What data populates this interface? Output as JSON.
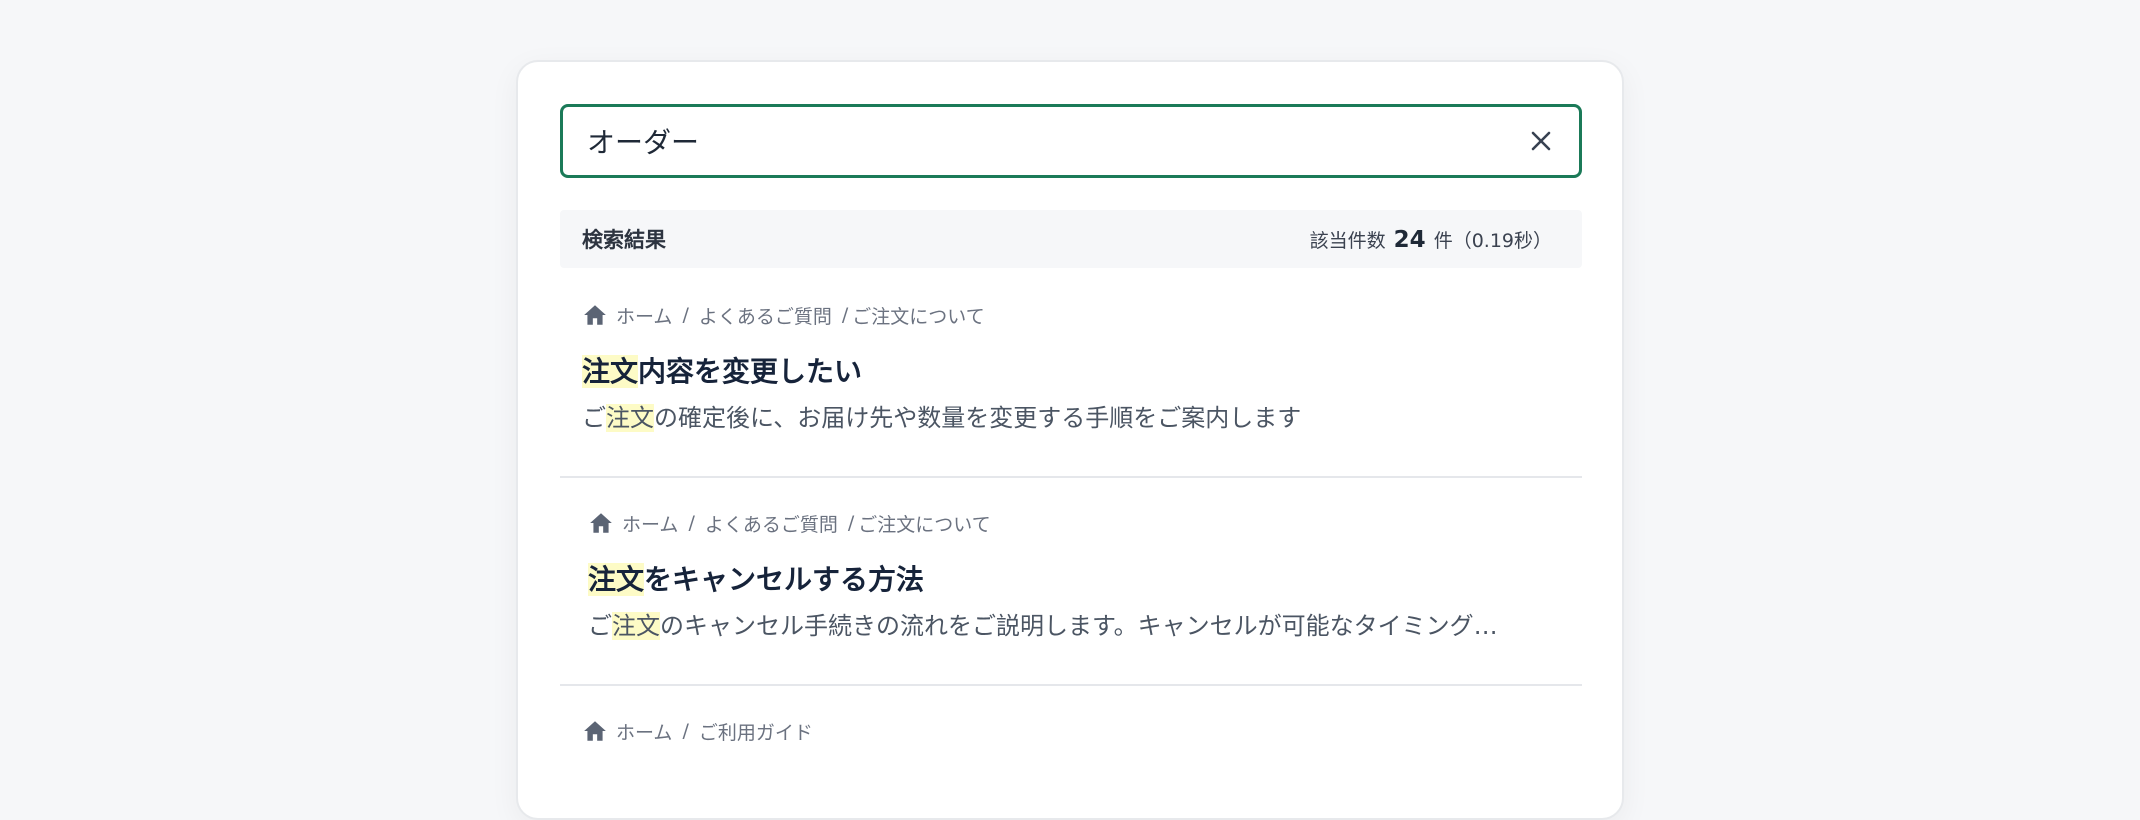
{
  "search": {
    "value": "オーダー"
  },
  "results_header": {
    "title": "検索結果",
    "count_label": "該当件数",
    "count": "24",
    "count_suffix": "件（0.19秒）"
  },
  "results": [
    {
      "breadcrumb": [
        "ホーム",
        "よくあるご質問",
        "ご注文について"
      ],
      "title_highlight": "注文",
      "title_rest": "内容を変更したい",
      "desc_prefix": "ご",
      "desc_highlight": "注文",
      "desc_rest": "の確定後に、お届け先や数量を変更する手順をご案内します"
    },
    {
      "breadcrumb": [
        "ホーム",
        "よくあるご質問",
        "ご注文について"
      ],
      "title_highlight": "注文",
      "title_rest": "をキャンセルする方法",
      "desc_prefix": "ご",
      "desc_highlight": "注文",
      "desc_rest": "のキャンセル手続きの流れをご説明します。キャンセルが可能なタイミング…"
    },
    {
      "breadcrumb": [
        "ホーム",
        "ご利用ガイド"
      ]
    }
  ],
  "colors": {
    "focus_border": "#1b7a58",
    "highlight": "#fdfbc6"
  },
  "icons": {
    "clear": "close-icon",
    "home": "home-icon"
  }
}
